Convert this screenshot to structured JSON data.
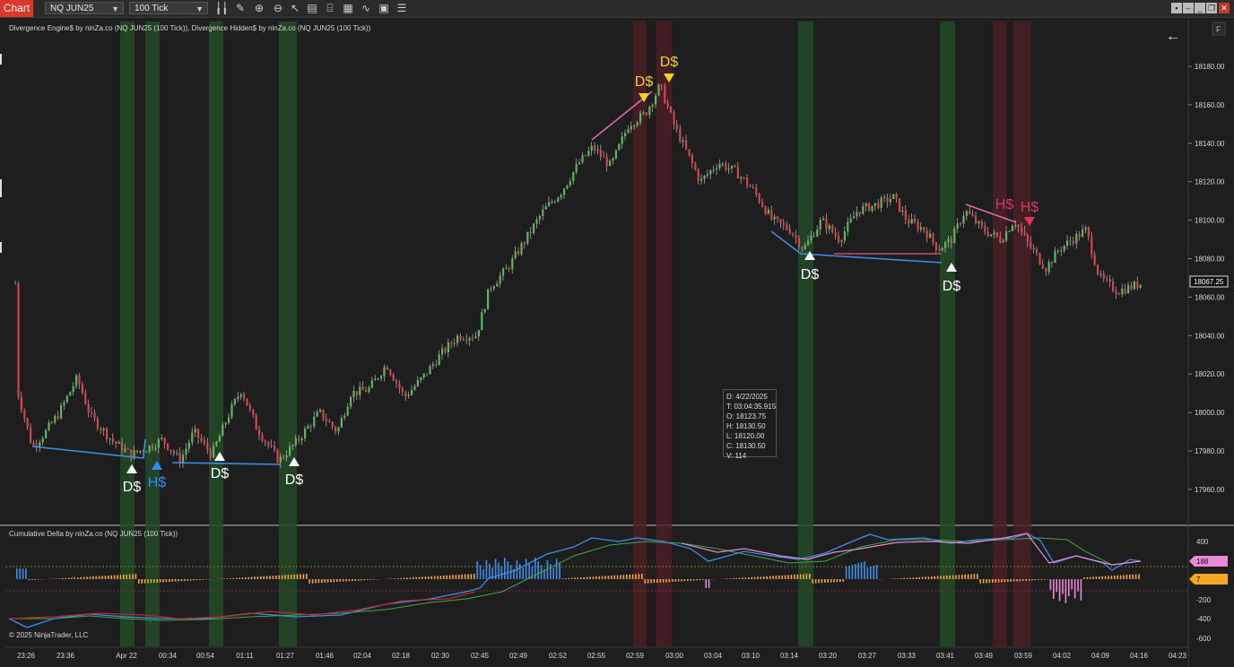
{
  "window": {
    "tab_label": "Chart",
    "instrument": "NQ JUN25",
    "interval": "100 Tick"
  },
  "panel_price": {
    "title": "Divergence Engine$ by ninZa.co (NQ JUN25 (100 Tick)), Divergence Hidden$ by ninZa.co (NQ JUN25 (100 Tick))",
    "y_ticks": [
      "18180.00",
      "18160.00",
      "18140.00",
      "18120.00",
      "18100.00",
      "18080.00",
      "18060.00",
      "18040.00",
      "18020.00",
      "18000.00",
      "17980.00",
      "17960.00"
    ],
    "last_price": "18067.25",
    "f_button": "F"
  },
  "panel_delta": {
    "title": "Cumulative Delta by ninZa.co (NQ JUN25 (100 Tick))",
    "y_ticks": [
      "400",
      "200",
      "0",
      "-200",
      "-400",
      "-600"
    ],
    "badge_upper": "188",
    "badge_lower": "7"
  },
  "x_ticks": [
    "23:26",
    "23:36",
    "Apr 22",
    "00:34",
    "00:54",
    "01:11",
    "01:27",
    "01:46",
    "02:04",
    "02:18",
    "02:30",
    "02:45",
    "02:49",
    "02:52",
    "02:55",
    "02:59",
    "03:00",
    "03:04",
    "03:10",
    "03:14",
    "03:20",
    "03:27",
    "03:33",
    "03:41",
    "03:49",
    "03:59",
    "04:02",
    "04:09",
    "04:16",
    "04:23"
  ],
  "signals": [
    {
      "text": "D$",
      "color": "#ffffff"
    },
    {
      "text": "H$",
      "color": "#2e8cff"
    },
    {
      "text": "D$",
      "color": "#ffffff"
    },
    {
      "text": "D$",
      "color": "#ffffff"
    },
    {
      "text": "D$",
      "color": "#f2d21b"
    },
    {
      "text": "D$",
      "color": "#f2d21b"
    },
    {
      "text": "D$",
      "color": "#ffffff"
    },
    {
      "text": "D$",
      "color": "#ffffff"
    },
    {
      "text": "H$",
      "color": "#e23462"
    },
    {
      "text": "H$",
      "color": "#e23462"
    }
  ],
  "data_box": {
    "d": "D: 4/22/2025",
    "t": "T:  03:04:35.915",
    "o": "O: 18123.75",
    "h": "H: 18130.50",
    "l": "L: 18120.00",
    "c": "C: 18130.50",
    "v": "V: 114"
  },
  "copyright": "© 2025 NinjaTrader, LLC",
  "colors": {
    "up_candle": "#5cb85c",
    "down_candle": "#e0404a",
    "bull_band": "#234a26",
    "bear_band": "#4a2026",
    "divergence_blue": "#3a8ee6",
    "divergence_pink": "#e06aa8"
  }
}
